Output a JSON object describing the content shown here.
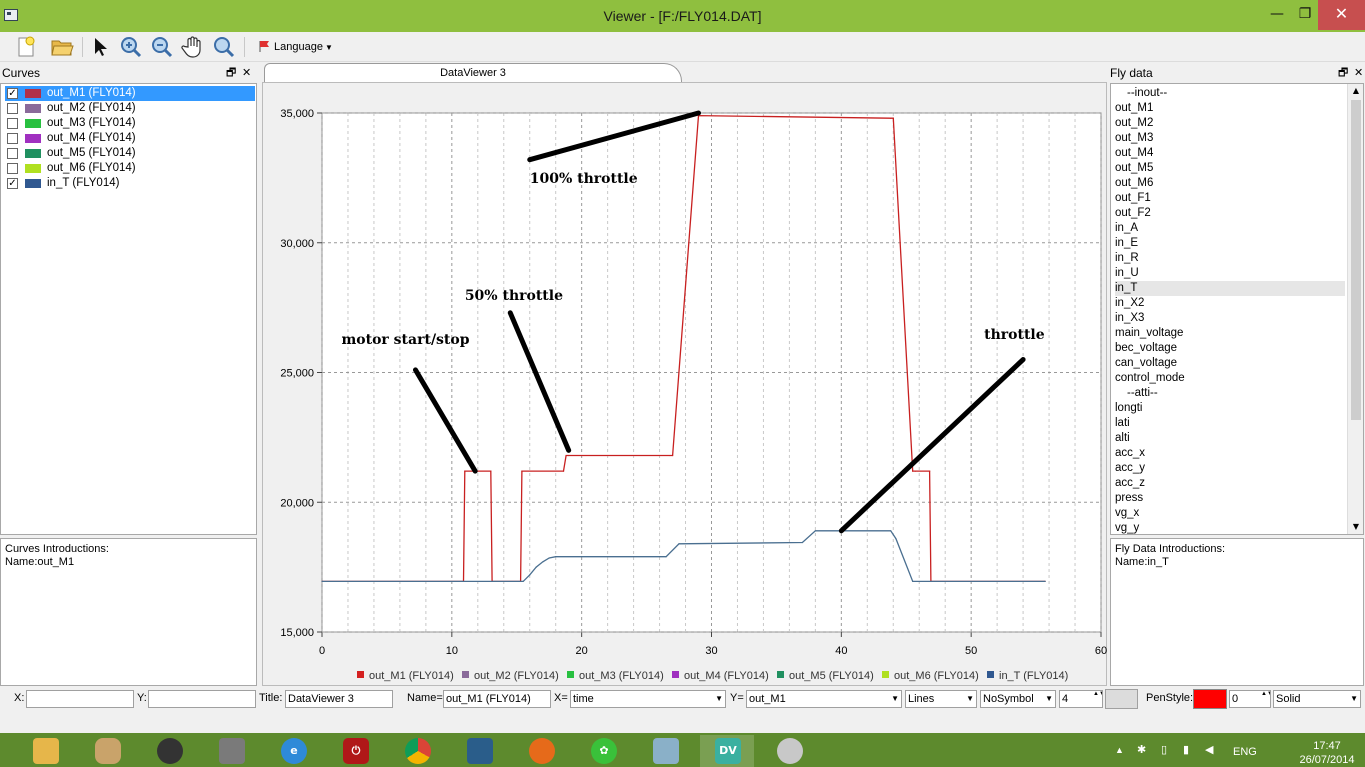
{
  "window": {
    "title": "Viewer - [F:/FLY014.DAT]",
    "minimize": "—",
    "restore": "❐",
    "close": "✕"
  },
  "toolbar": {
    "language_label": "Language",
    "items": [
      "new-icon",
      "open-folder-icon",
      "pointer-icon",
      "zoom-in-icon",
      "zoom-out-icon",
      "pan-hand-icon",
      "zoom-fit-icon",
      "flag-icon"
    ]
  },
  "curves_panel": {
    "title": "Curves",
    "items": [
      {
        "label": "out_M1 (FLY014)",
        "checked": true,
        "color": "#b03048"
      },
      {
        "label": "out_M2 (FLY014)",
        "checked": false,
        "color": "#8a6a9a"
      },
      {
        "label": "out_M3 (FLY014)",
        "checked": false,
        "color": "#28c040"
      },
      {
        "label": "out_M4 (FLY014)",
        "checked": false,
        "color": "#a030c0"
      },
      {
        "label": "out_M5 (FLY014)",
        "checked": false,
        "color": "#209060"
      },
      {
        "label": "out_M6 (FLY014)",
        "checked": false,
        "color": "#b0e020"
      },
      {
        "label": "in_T (FLY014)",
        "checked": true,
        "color": "#305890"
      }
    ],
    "intro_title": "Curves Introductions:",
    "intro_name": "Name:out_M1"
  },
  "fly_panel": {
    "title": "Fly data",
    "items": [
      "--inout--",
      "out_M1",
      "out_M2",
      "out_M3",
      "out_M4",
      "out_M5",
      "out_M6",
      "out_F1",
      "out_F2",
      "in_A",
      "in_E",
      "in_R",
      "in_U",
      "in_T",
      "in_X2",
      "in_X3",
      "main_voltage",
      "bec_voltage",
      "can_voltage",
      "control_mode",
      "--atti--",
      "longti",
      "lati",
      "alti",
      "acc_x",
      "acc_y",
      "acc_z",
      "press",
      "vg_x",
      "vg_y"
    ],
    "highlighted": "in_T",
    "intro_title": "Fly Data Introductions:",
    "intro_name": "Name:in_T"
  },
  "tab": {
    "label": "DataViewer 3"
  },
  "chart_data": {
    "type": "line",
    "xlim": [
      0,
      60
    ],
    "ylim": [
      15000,
      35000
    ],
    "x_ticks": [
      0,
      10,
      20,
      30,
      40,
      50,
      60
    ],
    "y_ticks": [
      15000,
      20000,
      25000,
      30000,
      35000
    ],
    "x_tick_labels": [
      "0",
      "10",
      "20",
      "30",
      "40",
      "50",
      "60"
    ],
    "y_tick_labels": [
      "15,000",
      "20,000",
      "25,000",
      "30,000",
      "35,000"
    ],
    "grid": true,
    "legend_position": "bottom",
    "legend": [
      {
        "name": "out_M1 (FLY014)",
        "color": "#d42020"
      },
      {
        "name": "out_M2 (FLY014)",
        "color": "#8a6a9a"
      },
      {
        "name": "out_M3 (FLY014)",
        "color": "#28c040"
      },
      {
        "name": "out_M4 (FLY014)",
        "color": "#a030c0"
      },
      {
        "name": "out_M5 (FLY014)",
        "color": "#209060"
      },
      {
        "name": "out_M6 (FLY014)",
        "color": "#b0e020"
      },
      {
        "name": "in_T (FLY014)",
        "color": "#305890"
      }
    ],
    "series": [
      {
        "name": "out_M1 (FLY014)",
        "color": "#c82020",
        "x": [
          0,
          10.9,
          11.0,
          13.0,
          13.1,
          15.3,
          15.4,
          18.6,
          18.8,
          19.0,
          26.8,
          27.0,
          29.0,
          43.8,
          44.0,
          45.5,
          45.7,
          46.8,
          46.9,
          55.7
        ],
        "y": [
          16950,
          16950,
          21200,
          21200,
          16950,
          16950,
          21200,
          21200,
          21800,
          21800,
          21800,
          21800,
          34900,
          34800,
          34800,
          21200,
          21200,
          21200,
          16950,
          16950
        ]
      },
      {
        "name": "in_T (FLY014)",
        "color": "#4a6f90",
        "x": [
          0,
          15.5,
          16.0,
          16.5,
          17.0,
          17.5,
          18.0,
          26.5,
          27.5,
          37.0,
          38.0,
          43.8,
          44.2,
          45.5,
          55.7
        ],
        "y": [
          16950,
          16950,
          17200,
          17500,
          17700,
          17850,
          17900,
          17900,
          18400,
          18450,
          18900,
          18900,
          18600,
          16950,
          16950
        ]
      }
    ],
    "annotations": [
      {
        "text": "100% throttle",
        "line": [
          [
            16,
            33200
          ],
          [
            29,
            35000
          ]
        ],
        "label_at": [
          16.0,
          32300
        ]
      },
      {
        "text": "50% throttle",
        "line": [
          [
            14.5,
            27300
          ],
          [
            19.0,
            22000
          ]
        ],
        "label_at": [
          11.0,
          27800
        ]
      },
      {
        "text": "motor start/stop",
        "line": [
          [
            7.2,
            25100
          ],
          [
            11.8,
            21200
          ]
        ],
        "label_at": [
          1.5,
          26100
        ]
      },
      {
        "text": "throttle",
        "line": [
          [
            54.0,
            25500
          ],
          [
            40.0,
            18900
          ]
        ],
        "label_at": [
          51.0,
          26300
        ]
      }
    ]
  },
  "statusbar": {
    "x_label": "X:",
    "y_label": "Y:",
    "x_value": "",
    "y_value": "",
    "title_label": "Title:",
    "title_value": "DataViewer 3",
    "name_label": "Name=",
    "name_value": "out_M1 (FLY014)",
    "xsel_label": "X=",
    "xsel_value": "time",
    "ysel_label": "Y=",
    "ysel_value": "out_M1",
    "line_style": "Lines",
    "symbol": "NoSymbol",
    "width": "4",
    "penstyle_label": "PenStyle:",
    "pen_color": "#ff0000",
    "pen_value": "0",
    "pen_type": "Solid"
  },
  "taskbar": {
    "apps": [
      "folder",
      "media-player",
      "speaker",
      "document",
      "internet-explorer",
      "power",
      "chrome",
      "app",
      "firefox",
      "icq",
      "manuscript",
      "DV",
      "paint"
    ],
    "active": "DV",
    "language": "ENG",
    "time": "17:47",
    "date": "26/07/2014"
  }
}
